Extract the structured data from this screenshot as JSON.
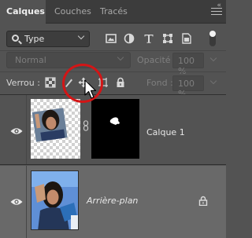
{
  "tabs": [
    {
      "label": "Calques",
      "active": true
    },
    {
      "label": "Couches",
      "active": false
    },
    {
      "label": "Tracés",
      "active": false
    }
  ],
  "collapse_glyph": "«",
  "filter": {
    "kind_label": "Type",
    "icons": [
      "image-filter-icon",
      "adjustment-filter-icon",
      "type-filter-icon",
      "shape-filter-icon",
      "smart-object-filter-icon"
    ]
  },
  "blend": {
    "mode": "Normal",
    "opacity_label": "Opacité :",
    "opacity_value": "100 %"
  },
  "lock": {
    "label": "Verrou :",
    "fill_label": "Fond :",
    "fill_value": "100 %"
  },
  "layers": [
    {
      "name": "Calque 1",
      "visible": true,
      "has_mask": true
    },
    {
      "name": "Arrière-plan",
      "visible": true,
      "locked": true
    }
  ],
  "colors": {
    "highlight_ring": "#d31516",
    "panel_bg": "#535353",
    "selected_layer_bg": "#696969"
  }
}
